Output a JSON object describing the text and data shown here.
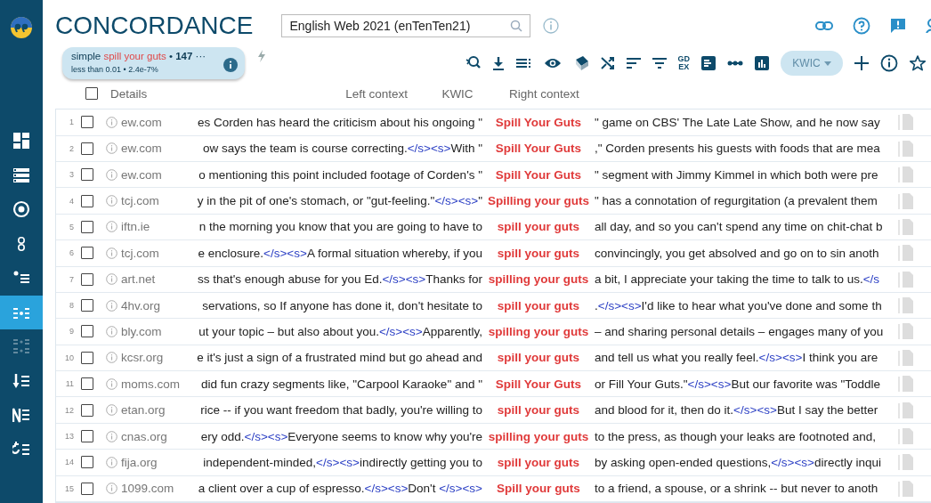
{
  "app": {
    "title": "CONCORDANCE",
    "corpus": {
      "value": "English Web 2021 (enTenTen21)"
    }
  },
  "sidebar": {
    "items": [
      {
        "selected": false,
        "disabled": false
      },
      {
        "selected": false,
        "disabled": false
      },
      {
        "selected": false,
        "disabled": false
      },
      {
        "selected": false,
        "disabled": false
      },
      {
        "selected": false,
        "disabled": false
      },
      {
        "selected": true,
        "disabled": false
      },
      {
        "selected": false,
        "disabled": true
      },
      {
        "selected": false,
        "disabled": false
      },
      {
        "selected": false,
        "disabled": false
      },
      {
        "selected": false,
        "disabled": false
      }
    ]
  },
  "query": {
    "type": "simple",
    "term": "spill your guts",
    "separator": "•",
    "hits": "147",
    "more": "···",
    "per_million": "less than 0.01",
    "percent": "2.4e-7%"
  },
  "toolbar": {
    "gdex": "GDEX",
    "view_select": {
      "label": "KWIC",
      "disabled": true
    }
  },
  "table": {
    "all_checked": false,
    "columns": [
      "Details",
      "Left context",
      "KWIC",
      "Right context"
    ],
    "rows": [
      {
        "num": "1",
        "checked": false,
        "source": "ew.com",
        "left": [
          {
            "kind": "text",
            "text": "es Corden has heard the criticism about his ongoing \""
          }
        ],
        "kwic": "Spill Your Guts",
        "right": [
          {
            "kind": "text",
            "text": "\" game on CBS' The Late Late Show, and he now say"
          }
        ]
      },
      {
        "num": "2",
        "checked": false,
        "source": "ew.com",
        "left": [
          {
            "kind": "text",
            "text": "ow says the team is course correcting."
          },
          {
            "kind": "tag",
            "text": "</s><s>"
          },
          {
            "kind": "text",
            "text": "With \""
          }
        ],
        "kwic": "Spill Your Guts",
        "right": [
          {
            "kind": "text",
            "text": ",\" Corden presents his guests with foods that are mea"
          }
        ]
      },
      {
        "num": "3",
        "checked": false,
        "source": "ew.com",
        "left": [
          {
            "kind": "text",
            "text": "o mentioning this point included footage of Corden's \""
          }
        ],
        "kwic": "Spill Your Guts",
        "right": [
          {
            "kind": "text",
            "text": "\" segment with Jimmy Kimmel in which both were pre"
          }
        ]
      },
      {
        "num": "4",
        "checked": false,
        "source": "tcj.com",
        "left": [
          {
            "kind": "text",
            "text": "y in the pit of one's stomach, or \"gut-feeling.\""
          },
          {
            "kind": "tag",
            "text": "</s><s>"
          },
          {
            "kind": "text",
            "text": "\""
          }
        ],
        "kwic": "Spilling your guts",
        "right": [
          {
            "kind": "text",
            "text": "\" has a connotation of regurgitation (a prevalent them"
          }
        ]
      },
      {
        "num": "5",
        "checked": false,
        "source": "iftn.ie",
        "left": [
          {
            "kind": "text",
            "text": "n the morning you know that you are going to have to"
          }
        ],
        "kwic": "spill your guts",
        "right": [
          {
            "kind": "text",
            "text": "all day, and so you can't spend any time on chit-chat b"
          }
        ]
      },
      {
        "num": "6",
        "checked": false,
        "source": "tcj.com",
        "left": [
          {
            "kind": "text",
            "text": "e enclosure."
          },
          {
            "kind": "tag",
            "text": "</s><s>"
          },
          {
            "kind": "text",
            "text": "A formal situation whereby, if you"
          }
        ],
        "kwic": "spill your guts",
        "right": [
          {
            "kind": "text",
            "text": "convincingly, you get absolved and go on to sin anoth"
          }
        ]
      },
      {
        "num": "7",
        "checked": false,
        "source": "art.net",
        "left": [
          {
            "kind": "text",
            "text": "ss that's enough abuse for you Ed."
          },
          {
            "kind": "tag",
            "text": "</s><s>"
          },
          {
            "kind": "text",
            "text": "Thanks for"
          }
        ],
        "kwic": "spilling your guts",
        "right": [
          {
            "kind": "text",
            "text": "a bit, I appreciate your taking the time to talk to us."
          },
          {
            "kind": "tag",
            "text": "</s"
          }
        ]
      },
      {
        "num": "8",
        "checked": false,
        "source": "4hv.org",
        "left": [
          {
            "kind": "text",
            "text": "servations, so If anyone has done it, don't hesitate to"
          }
        ],
        "kwic": "spill your guts",
        "right": [
          {
            "kind": "text",
            "text": "."
          },
          {
            "kind": "tag",
            "text": "</s><s>"
          },
          {
            "kind": "text",
            "text": "I'd like to hear what you've done and some th"
          }
        ]
      },
      {
        "num": "9",
        "checked": false,
        "source": "bly.com",
        "left": [
          {
            "kind": "text",
            "text": "ut your topic – but also about you."
          },
          {
            "kind": "tag",
            "text": "</s><s>"
          },
          {
            "kind": "text",
            "text": "Apparently,"
          }
        ],
        "kwic": "spilling your guts",
        "right": [
          {
            "kind": "text",
            "text": "– and sharing personal details – engages many of you"
          }
        ]
      },
      {
        "num": "10",
        "checked": false,
        "source": "kcsr.org",
        "left": [
          {
            "kind": "text",
            "text": "e it's just a sign of a frustrated mind but go ahead and"
          }
        ],
        "kwic": "spill your guts",
        "right": [
          {
            "kind": "text",
            "text": "and tell us what you really feel."
          },
          {
            "kind": "tag",
            "text": "</s><s>"
          },
          {
            "kind": "text",
            "text": "I think you are"
          }
        ]
      },
      {
        "num": "11",
        "checked": false,
        "source": "moms.com",
        "left": [
          {
            "kind": "text",
            "text": "did fun crazy segments like, \"Carpool Karaoke\" and \""
          }
        ],
        "kwic": "Spill Your Guts",
        "right": [
          {
            "kind": "text",
            "text": "or Fill Your Guts.\""
          },
          {
            "kind": "tag",
            "text": "</s><s>"
          },
          {
            "kind": "text",
            "text": "But our favorite was \"Toddle"
          }
        ]
      },
      {
        "num": "12",
        "checked": false,
        "source": "etan.org",
        "left": [
          {
            "kind": "text",
            "text": "rice -- if you want freedom that badly, you're willing to"
          }
        ],
        "kwic": "spill your guts",
        "right": [
          {
            "kind": "text",
            "text": "and blood for it, then do it."
          },
          {
            "kind": "tag",
            "text": "</s><s>"
          },
          {
            "kind": "text",
            "text": "But I say the better"
          }
        ]
      },
      {
        "num": "13",
        "checked": false,
        "source": "cnas.org",
        "left": [
          {
            "kind": "text",
            "text": "ery odd."
          },
          {
            "kind": "tag",
            "text": "</s><s>"
          },
          {
            "kind": "text",
            "text": "Everyone seems to know why you're"
          }
        ],
        "kwic": "spilling your guts",
        "right": [
          {
            "kind": "text",
            "text": "to the press, as though your leaks are footnoted and,"
          }
        ]
      },
      {
        "num": "14",
        "checked": false,
        "source": "fija.org",
        "left": [
          {
            "kind": "text",
            "text": "independent-minded,"
          },
          {
            "kind": "tag",
            "text": "</s><s>"
          },
          {
            "kind": "text",
            "text": "indirectly getting you to"
          }
        ],
        "kwic": "spill your guts",
        "right": [
          {
            "kind": "text",
            "text": "by asking open-ended questions,"
          },
          {
            "kind": "tag",
            "text": "</s><s>"
          },
          {
            "kind": "text",
            "text": "directly inqui"
          }
        ]
      },
      {
        "num": "15",
        "checked": false,
        "source": "1099.com",
        "left": [
          {
            "kind": "text",
            "text": "a client over a cup of espresso."
          },
          {
            "kind": "tag",
            "text": "</s><s>"
          },
          {
            "kind": "text",
            "text": "Don't "
          },
          {
            "kind": "tag",
            "text": "</s><s>"
          }
        ],
        "kwic": "Spill your guts",
        "right": [
          {
            "kind": "text",
            "text": "to a friend, a spouse, or a shrink -- but never to anoth"
          }
        ]
      }
    ]
  }
}
